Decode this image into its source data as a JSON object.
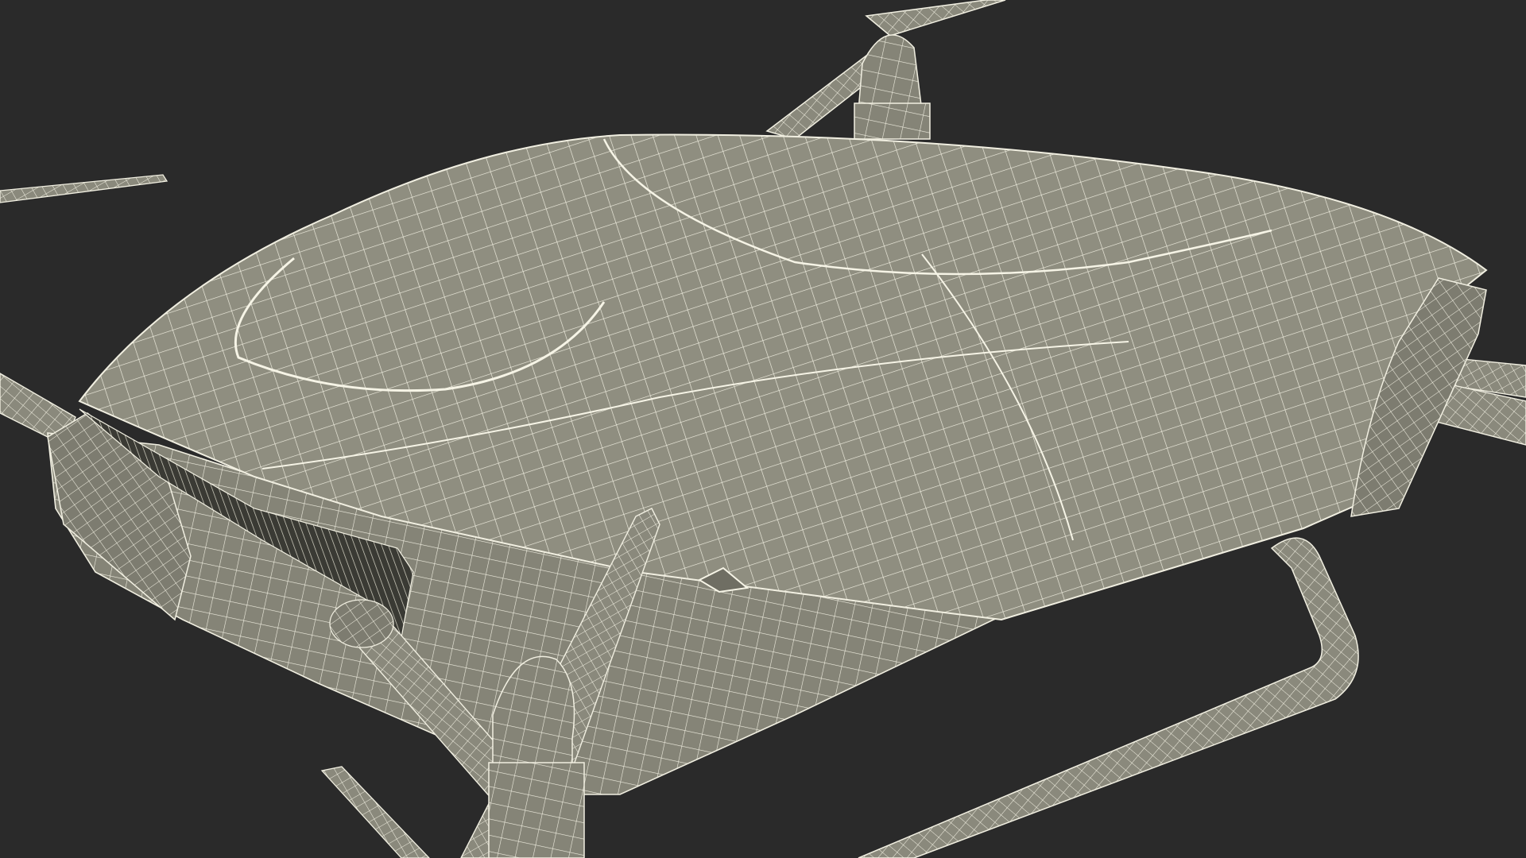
{
  "viewport": {
    "background": "#2a2a2a"
  },
  "model": {
    "surface_color": "#8d8c7e",
    "surface_shadow": "#6f6e63",
    "surface_light": "#a09f91",
    "wire_color": "#f1efe1",
    "parts": [
      "body-shell-top",
      "body-front-nose",
      "vent-grille",
      "landing-skid",
      "rotor-hub-front",
      "rotor-hub-rear",
      "rotor-arm-front-left",
      "rotor-arm-front-right",
      "rotor-arm-rear-left",
      "rotor-arm-rear-right",
      "propeller-blade"
    ]
  }
}
